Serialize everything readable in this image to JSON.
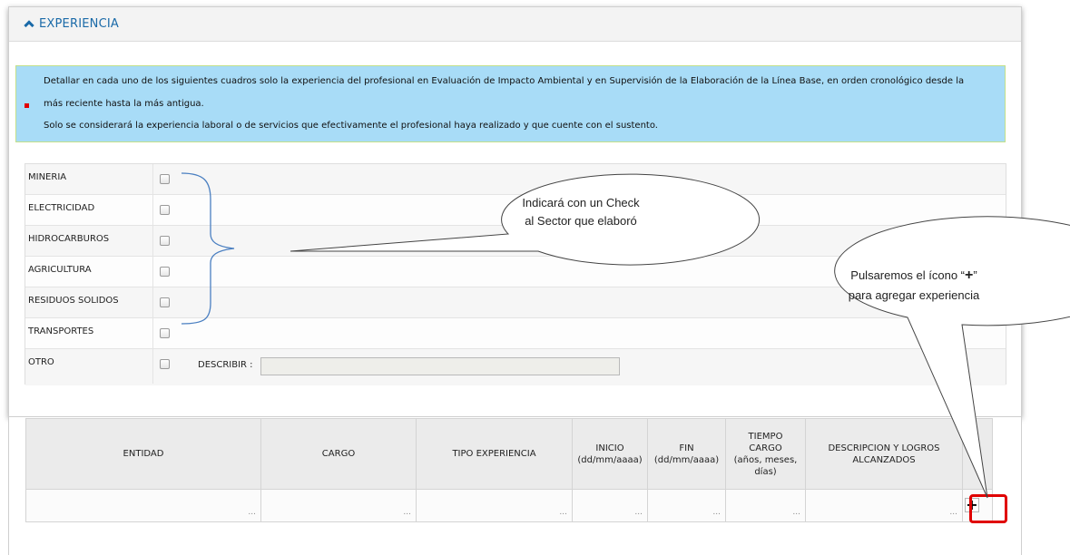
{
  "section": {
    "title": "EXPERIENCIA"
  },
  "info": {
    "line1": "Detallar en cada uno de los siguientes cuadros solo la experiencia del profesional en Evaluación de Impacto Ambiental y en Supervisión de la Elaboración de la Línea Base, en orden cronológico desde la",
    "line2": "más reciente hasta la más antigua.",
    "line3": "Solo se considerará la experiencia laboral o de servicios que efectivamente el profesional haya realizado y que cuente con el sustento."
  },
  "sectors": [
    {
      "label": "MINERIA",
      "checked": false
    },
    {
      "label": "ELECTRICIDAD",
      "checked": false
    },
    {
      "label": "HIDROCARBUROS",
      "checked": false
    },
    {
      "label": "AGRICULTURA",
      "checked": false
    },
    {
      "label": "RESIDUOS SOLIDOS",
      "checked": false
    },
    {
      "label": "TRANSPORTES",
      "checked": false
    },
    {
      "label": "OTRO",
      "checked": false
    }
  ],
  "describir": {
    "label": "DESCRIBIR :",
    "value": ""
  },
  "table": {
    "headers": {
      "entidad": "ENTIDAD",
      "cargo": "CARGO",
      "tipo": "TIPO EXPERIENCIA",
      "inicio_1": "INICIO",
      "inicio_2": "(dd/mm/aaaa)",
      "fin_1": "FIN",
      "fin_2": "(dd/mm/aaaa)",
      "tiempo_1": "TIEMPO",
      "tiempo_2": "CARGO",
      "tiempo_3": "(años, meses,",
      "tiempo_4": "días)",
      "desc_1": "DESCRIPCION Y LOGROS",
      "desc_2": "ALCANZADOS"
    },
    "empty_row": [
      "...",
      "...",
      "...",
      "...",
      "...",
      "...",
      "..."
    ],
    "add_icon": "plus-icon",
    "add_symbol": "+"
  },
  "callouts": {
    "sector_1": "Indicará con un Check",
    "sector_2": "al Sector que elaboró",
    "add_1_pre": "Pulsaremos el ícono “",
    "add_1_plus": "+",
    "add_1_post": "”",
    "add_2": "para agregar experiencia"
  },
  "colors": {
    "accent": "#1a6aa8",
    "info_bg": "#a8dcf7",
    "bullet": "#e00000",
    "highlight": "#e00000",
    "brace": "#4a7fc1"
  }
}
